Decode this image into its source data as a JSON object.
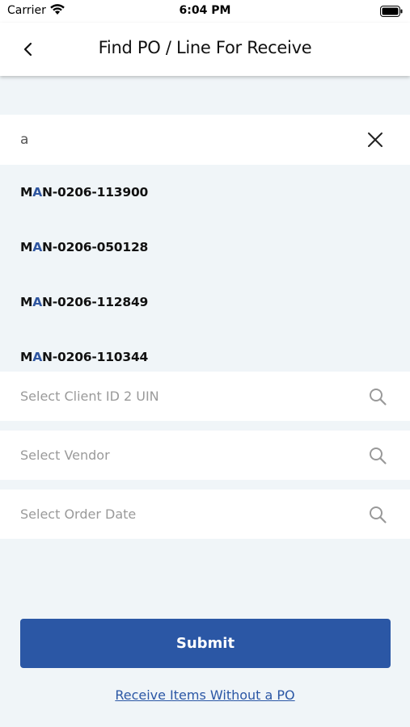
{
  "status_bar": {
    "carrier": "Carrier",
    "time": "6:04 PM"
  },
  "nav": {
    "title": "Find PO / Line For Receive",
    "back_icon": "chevron-left-icon"
  },
  "search": {
    "value": "a",
    "clear_icon": "close-icon"
  },
  "results": [
    {
      "prefix": "M",
      "match": "A",
      "suffix": "N-0206-113900"
    },
    {
      "prefix": "M",
      "match": "A",
      "suffix": "N-0206-050128"
    },
    {
      "prefix": "M",
      "match": "A",
      "suffix": "N-0206-112849"
    },
    {
      "prefix": "M",
      "match": "A",
      "suffix": "N-0206-110344"
    }
  ],
  "fields": {
    "client": {
      "placeholder": "Select Client ID 2 UIN",
      "icon": "search-icon"
    },
    "vendor": {
      "placeholder": "Select Vendor",
      "icon": "search-icon"
    },
    "order_date": {
      "placeholder": "Select Order Date",
      "icon": "search-icon"
    }
  },
  "submit_label": "Submit",
  "receive_without_po_label": "Receive Items Without a PO",
  "colors": {
    "accent": "#2b57a5",
    "background": "#f0f5f8",
    "match_highlight": "#2f56a0"
  }
}
